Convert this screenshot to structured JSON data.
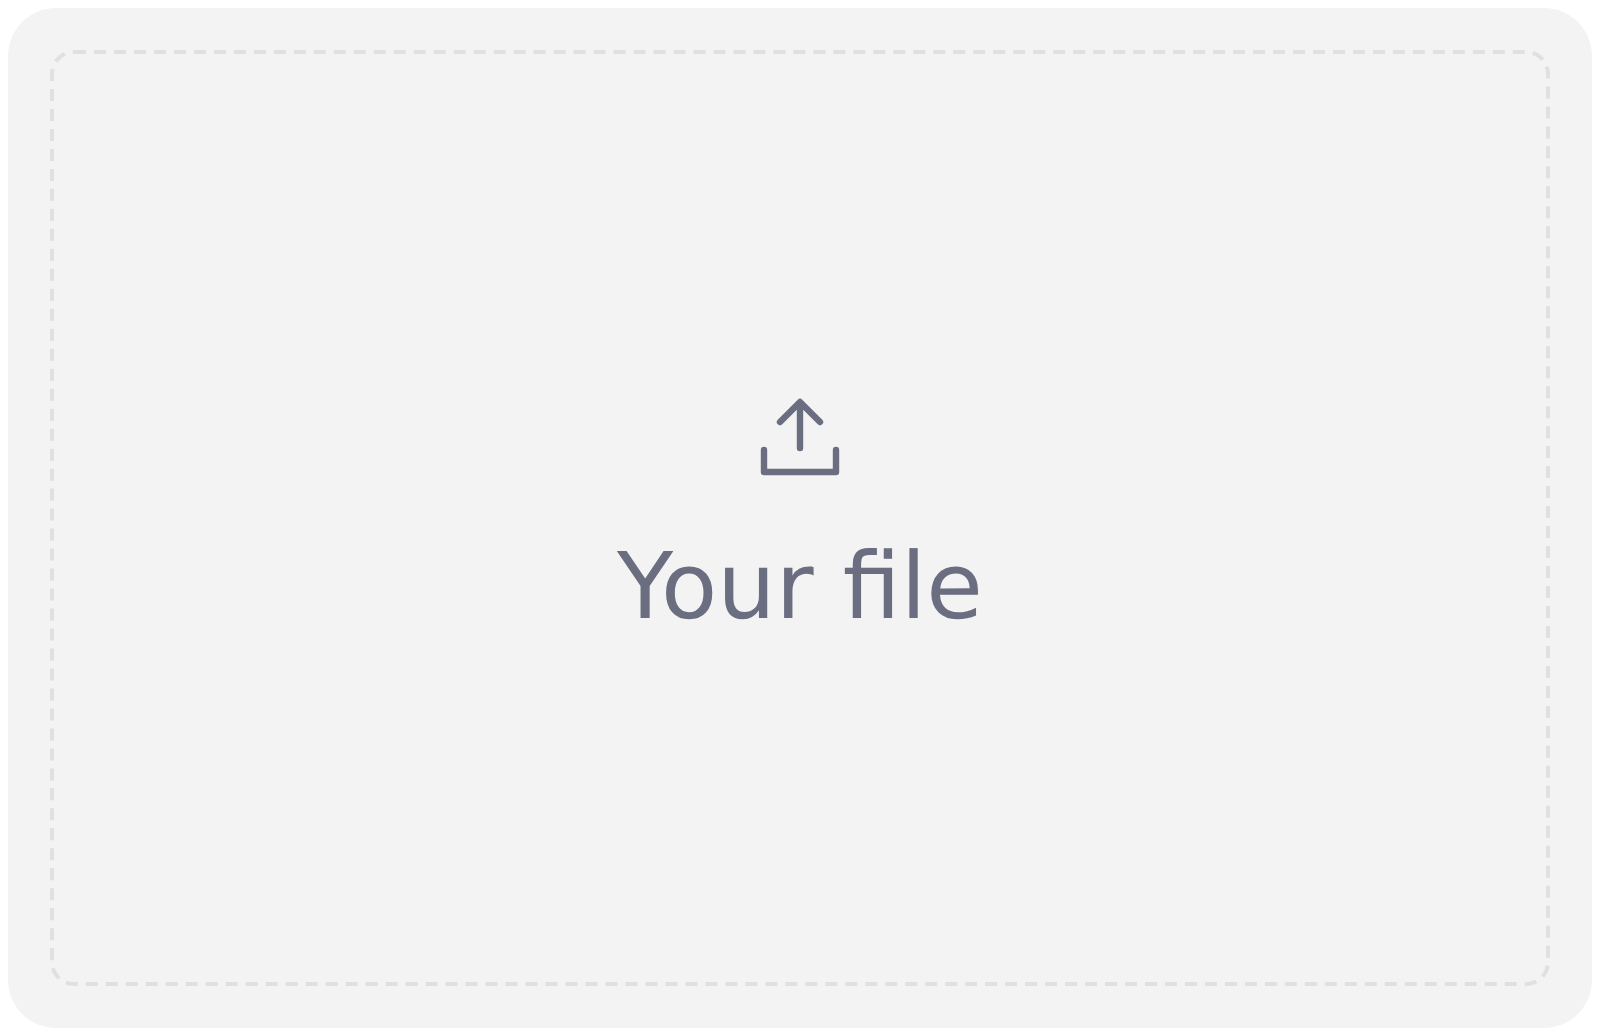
{
  "dropzone": {
    "label": "Your file"
  }
}
